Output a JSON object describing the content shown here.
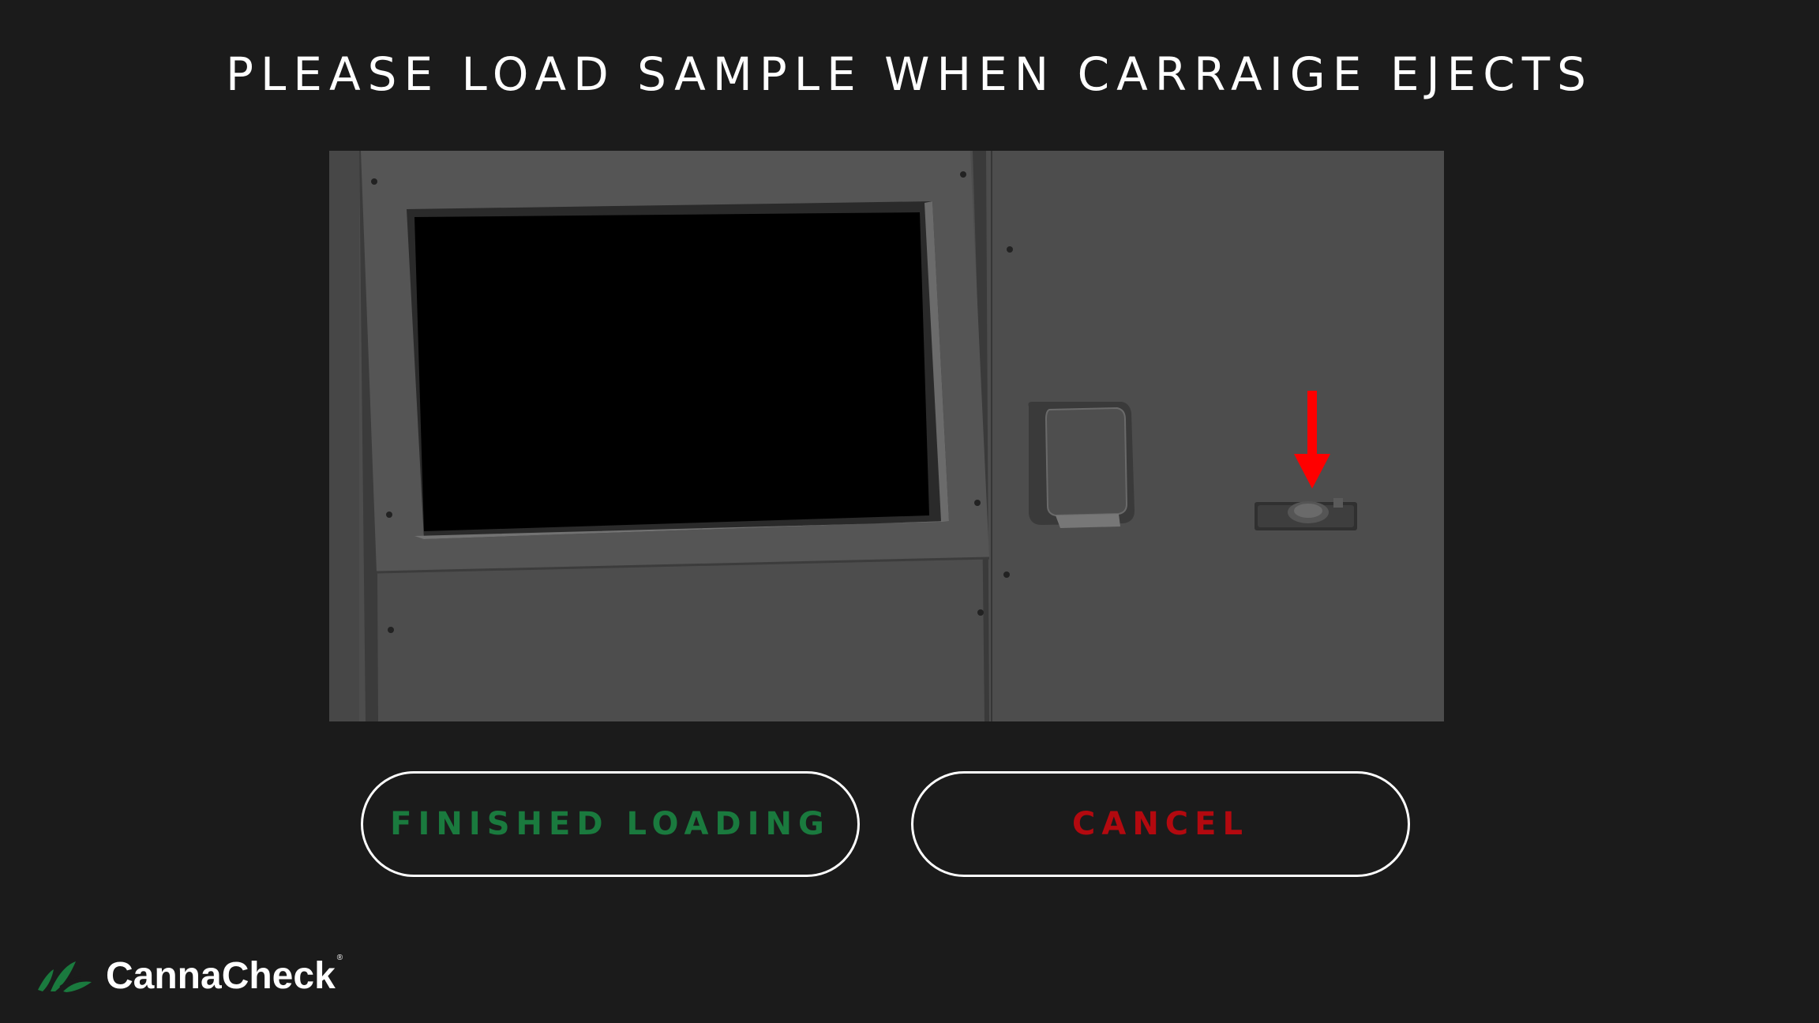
{
  "prompt": {
    "title": "PLEASE LOAD SAMPLE WHEN CARRAIGE EJECTS"
  },
  "actions": {
    "finished_label": "FINISHED LOADING",
    "cancel_label": "CANCEL"
  },
  "brand": {
    "name": "CannaCheck",
    "registered_mark": "®"
  },
  "illustration": {
    "indicator": "arrow-down-icon",
    "subject": "sample-carriage"
  },
  "colors": {
    "background": "#1b1b1b",
    "finished_text": "#1a7a3e",
    "cancel_text": "#b3090f",
    "button_border": "#ffffff",
    "arrow": "#ff0000",
    "brand_green": "#1a7a3e"
  }
}
